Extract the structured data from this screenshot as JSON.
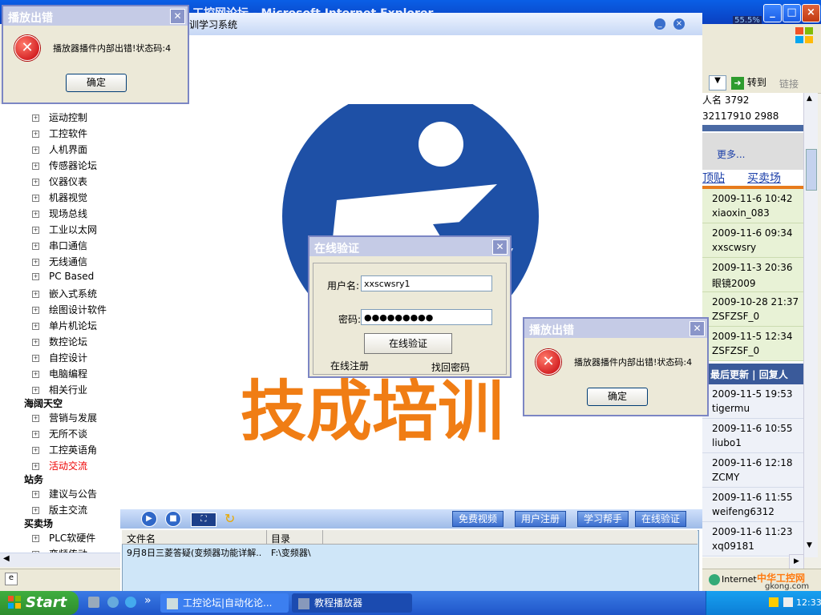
{
  "ie": {
    "title": "工控网论坛 - Microsoft Internet Explorer",
    "go_label": "转到",
    "links_label": "链接",
    "meter": "55.5%"
  },
  "tree": {
    "items_top": [
      "运动控制",
      "工控软件",
      "人机界面",
      "传感器论坛",
      "仪器仪表",
      "机器视觉",
      "现场总线",
      "工业以太网",
      "串口通信",
      "无线通信",
      "PC Based",
      "嵌入式系统",
      "绘图设计软件",
      "单片机论坛",
      "数控论坛",
      "自控设计",
      "电脑编程",
      "相关行业"
    ],
    "section1": "海阔天空",
    "items_mid": [
      "营销与发展",
      "无所不谈",
      "工控英语角",
      "活动交流"
    ],
    "section2": "站务",
    "items_site": [
      "建议与公告",
      "版主交流"
    ],
    "section3": "买卖场",
    "items_market": [
      "PLC软硬件",
      "变频传动"
    ]
  },
  "right": {
    "line1": "人名  3792",
    "line2": "32117910   2988",
    "more": "更多...",
    "tab1": "顶贴",
    "tab2": "买卖场",
    "entries_a": [
      {
        "date": "2009-11-6 10:42",
        "user": "xiaoxin_083"
      },
      {
        "date": "2009-11-6 09:34",
        "user": "xxscwsry"
      },
      {
        "date": "2009-11-3 20:36",
        "user": "眼镜2009"
      },
      {
        "date": "2009-10-28 21:37",
        "user": "ZSFZSF_0"
      },
      {
        "date": "2009-11-5 12:34",
        "user": "ZSFZSF_0"
      }
    ],
    "head": "最后更新 | 回复人",
    "entries_b": [
      {
        "date": "2009-11-5 19:53",
        "user": "tigermu"
      },
      {
        "date": "2009-11-6 10:55",
        "user": "liubo1"
      },
      {
        "date": "2009-11-6 12:18",
        "user": "ZCMY"
      },
      {
        "date": "2009-11-6 11:55",
        "user": "weifeng6312"
      },
      {
        "date": "2009-11-6 11:23",
        "user": "xq09181"
      }
    ]
  },
  "player": {
    "title": "训学习系统",
    "controls": [
      "免费视频",
      "用户注册",
      "学习帮手",
      "在线验证"
    ],
    "list_headers": [
      "文件名",
      "目录"
    ],
    "list_row": {
      "name": "9月8日三菱答疑(变频器功能详解..",
      "dir": "F:\\变频器\\"
    }
  },
  "logo": {
    "text": "技成培训"
  },
  "error_dialog": {
    "title": "播放出错",
    "message": "播放器播件内部出错!状态码:4",
    "ok": "确定"
  },
  "login": {
    "title": "在线验证",
    "user_label": "用户名:",
    "user_value": "xxscwsry1",
    "pass_label": "密码:",
    "pass_value": "●●●●●●●●●",
    "verify_btn": "在线验证",
    "register_link": "在线注册",
    "recover_link": "找回密码"
  },
  "statusbar": {
    "zone": "Internet",
    "watermark": "中华工控网",
    "site": "gkong.com"
  },
  "taskbar": {
    "start": "Start",
    "tasks": [
      "工控论坛|自动化论...",
      "教程播放器"
    ],
    "clock": "12:33",
    "more": "»"
  }
}
